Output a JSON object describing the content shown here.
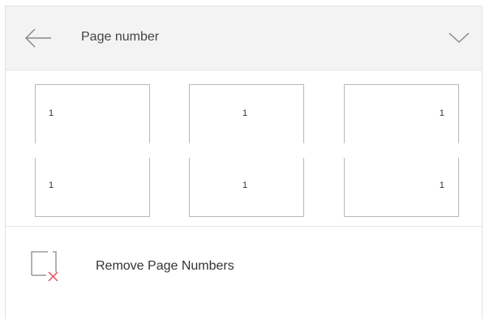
{
  "header": {
    "title": "Page number",
    "back_icon": "arrow-left-icon",
    "collapse_icon": "chevron-down-icon"
  },
  "options": [
    {
      "position": "left",
      "top_number": "1",
      "bottom_number": "1"
    },
    {
      "position": "center",
      "top_number": "1",
      "bottom_number": "1"
    },
    {
      "position": "right",
      "top_number": "1",
      "bottom_number": "1"
    }
  ],
  "remove": {
    "label": "Remove Page Numbers",
    "icon": "remove-page-number-icon",
    "accent_color": "#e8505b"
  }
}
